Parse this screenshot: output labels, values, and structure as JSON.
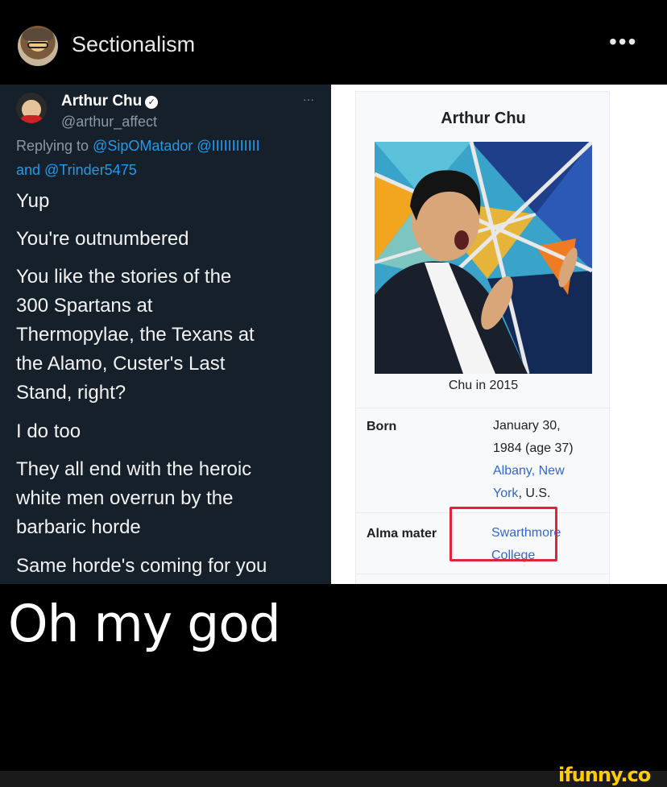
{
  "post": {
    "username": "Sectionalism",
    "more_label": "•••"
  },
  "tweet": {
    "name": "Arthur Chu",
    "handle": "@arthur_affect",
    "more": "···",
    "reply_prefix": "Replying to",
    "reply_mentions": "@SipOMatador @IIIIIIIIIIII",
    "reply_and": "and",
    "reply_mention2": "@Trinder5475",
    "lines": [
      "Yup",
      "You're outnumbered",
      "You like the stories of the",
      "300 Spartans at",
      "Thermopylae, the Texans at",
      "the Alamo, Custer's Last",
      "Stand, right?",
      "I do too",
      "They all end with the heroic",
      "white men overrun by the",
      "barbaric horde",
      "Same horde's coming for you"
    ]
  },
  "wiki": {
    "title": "Arthur Chu",
    "caption": "Chu in 2015",
    "born_label": "Born",
    "born_date": "January 30,",
    "born_age": "1984 (age 37)",
    "born_place1": "Albany, New",
    "born_place2_link": "York",
    "born_place2_rest": ", U.S.",
    "alma_label": "Alma mater",
    "alma_value1": "Swarthmore",
    "alma_value2": "College",
    "highlight_color": "#e0243a",
    "link_color": "#3366cc"
  },
  "caption": "Oh my god",
  "footer": {
    "logo": "ifunny.co"
  }
}
